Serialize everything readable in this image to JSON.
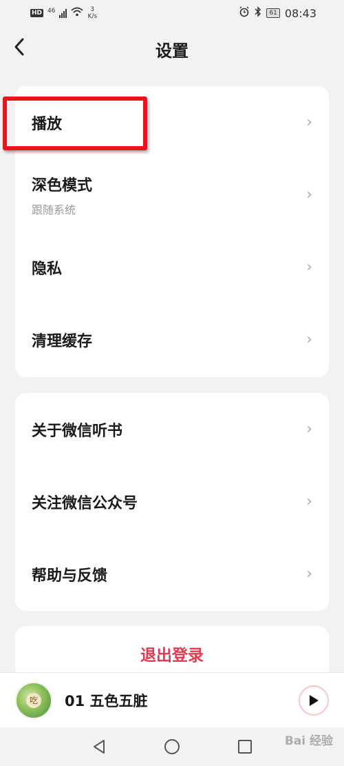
{
  "status_bar": {
    "hd": "HD",
    "network": "46",
    "speed_value": "3",
    "speed_unit": "K/s",
    "battery": "61",
    "time": "08:43"
  },
  "header": {
    "title": "设置"
  },
  "settings_group_1": {
    "items": [
      {
        "label": "播放",
        "sub": ""
      },
      {
        "label": "深色模式",
        "sub": "跟随系统"
      },
      {
        "label": "隐私",
        "sub": ""
      },
      {
        "label": "清理缓存",
        "sub": ""
      }
    ]
  },
  "settings_group_2": {
    "items": [
      {
        "label": "关于微信听书"
      },
      {
        "label": "关注微信公众号"
      },
      {
        "label": "帮助与反馈"
      }
    ]
  },
  "logout": {
    "label": "退出登录"
  },
  "mini_player": {
    "cover_text": "吃",
    "track_title": "01 五色五脏"
  },
  "watermark": {
    "text": "Bai 经验"
  },
  "colors": {
    "accent_red": "#e8384f",
    "highlight_red": "#e8161c",
    "background": "#f2f2f2"
  }
}
